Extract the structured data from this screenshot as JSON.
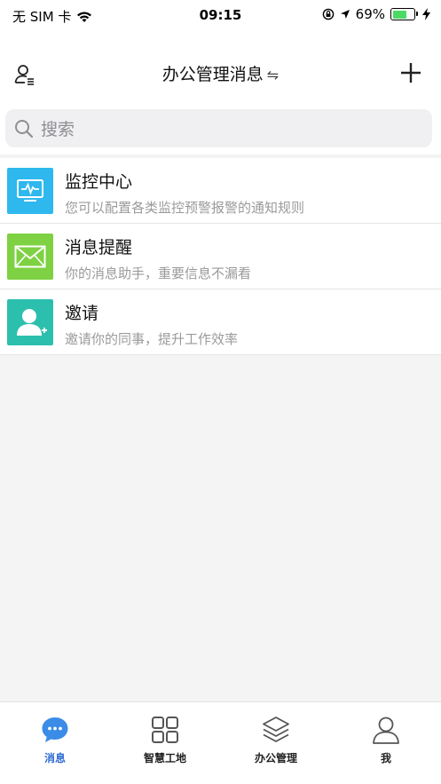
{
  "status_bar": {
    "carrier": "无 SIM 卡",
    "time": "09:15",
    "battery_percent": "69%",
    "battery_level": 0.69,
    "icons": [
      "wifi-icon",
      "orientation-lock-icon",
      "location-arrow-icon",
      "battery-icon",
      "charging-bolt-icon"
    ]
  },
  "header": {
    "title": "办公管理消息",
    "swap_symbol": "⇋",
    "left_icon": "contacts-icon",
    "right_icon": "add-icon"
  },
  "search": {
    "placeholder": "搜索"
  },
  "list": [
    {
      "title": "监控中心",
      "subtitle": "您可以配置各类监控预警报警的通知规则",
      "icon": "monitor-icon",
      "color": "#2eb8ee"
    },
    {
      "title": "消息提醒",
      "subtitle": "你的消息助手，重要信息不漏看",
      "icon": "mail-icon",
      "color": "#7ed142"
    },
    {
      "title": "邀请",
      "subtitle": "邀请你的同事，提升工作效率",
      "icon": "add-user-icon",
      "color": "#2dbfae"
    }
  ],
  "tabs": [
    {
      "label": "消息",
      "icon": "chat-bubble-icon",
      "active": true
    },
    {
      "label": "智慧工地",
      "icon": "grid-icon",
      "active": false
    },
    {
      "label": "办公管理",
      "icon": "layers-icon",
      "active": false
    },
    {
      "label": "我",
      "icon": "user-icon",
      "active": false
    }
  ],
  "colors": {
    "accent": "#2f6bd3",
    "background": "#f4f4f5"
  }
}
